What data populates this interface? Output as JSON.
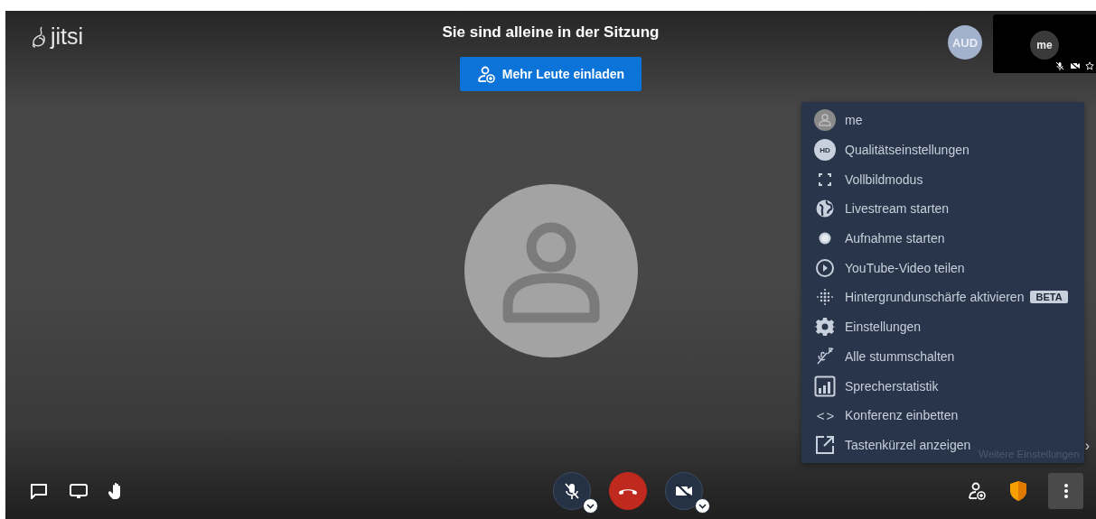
{
  "logo": {
    "text": "jitsi"
  },
  "header": {
    "title": "Sie sind alleine in der Sitzung",
    "invite_button": "Mehr Leute einladen"
  },
  "remote_avatar": {
    "initials": "AUD"
  },
  "self_view": {
    "name": "me",
    "mic_muted": true,
    "camera_muted": true
  },
  "menu": {
    "items": [
      {
        "kind": "avatar",
        "label": "me"
      },
      {
        "kind": "hd",
        "label": "Qualitätseinstellungen",
        "badge_text": "HD"
      },
      {
        "kind": "fullscreen",
        "label": "Vollbildmodus"
      },
      {
        "kind": "globe",
        "label": "Livestream starten"
      },
      {
        "kind": "record",
        "label": "Aufnahme starten"
      },
      {
        "kind": "play",
        "label": "YouTube-Video teilen"
      },
      {
        "kind": "blur",
        "label": "Hintergrundunschärfe aktivieren",
        "badge": "BETA"
      },
      {
        "kind": "gear",
        "label": "Einstellungen"
      },
      {
        "kind": "muteall",
        "label": "Alle stummschalten"
      },
      {
        "kind": "stats",
        "label": "Sprecherstatistik"
      },
      {
        "kind": "code",
        "label": "Konferenz einbetten",
        "icon_text": "< >"
      },
      {
        "kind": "external",
        "label": "Tastenkürzel anzeigen"
      }
    ],
    "tooltip": "Weitere Einstellungen",
    "submenu_arrow": "›"
  },
  "toolbar": {
    "mic_muted": true,
    "camera_muted": true,
    "more_selected": true
  }
}
